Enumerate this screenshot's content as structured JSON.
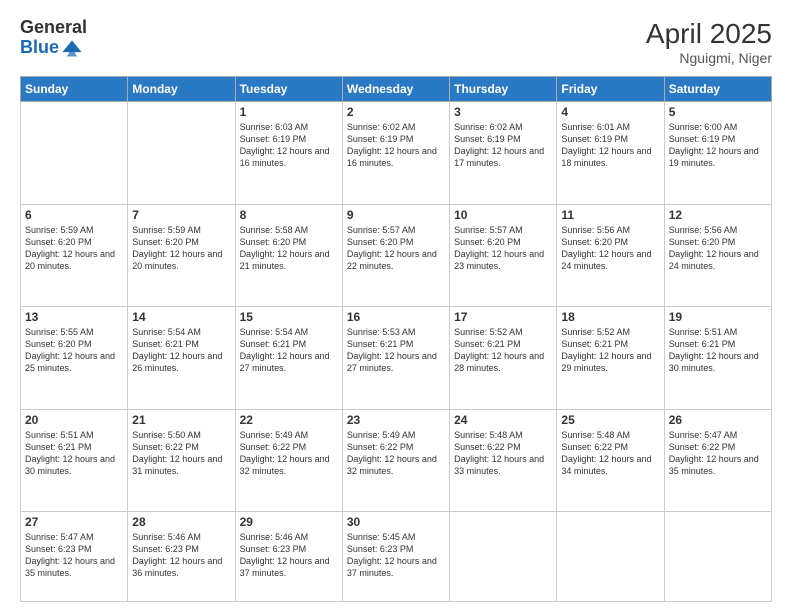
{
  "header": {
    "logo_general": "General",
    "logo_blue": "Blue",
    "month_year": "April 2025",
    "location": "Nguigmi, Niger"
  },
  "days_of_week": [
    "Sunday",
    "Monday",
    "Tuesday",
    "Wednesday",
    "Thursday",
    "Friday",
    "Saturday"
  ],
  "weeks": [
    [
      {
        "day": "",
        "info": ""
      },
      {
        "day": "",
        "info": ""
      },
      {
        "day": "1",
        "info": "Sunrise: 6:03 AM\nSunset: 6:19 PM\nDaylight: 12 hours and 16 minutes."
      },
      {
        "day": "2",
        "info": "Sunrise: 6:02 AM\nSunset: 6:19 PM\nDaylight: 12 hours and 16 minutes."
      },
      {
        "day": "3",
        "info": "Sunrise: 6:02 AM\nSunset: 6:19 PM\nDaylight: 12 hours and 17 minutes."
      },
      {
        "day": "4",
        "info": "Sunrise: 6:01 AM\nSunset: 6:19 PM\nDaylight: 12 hours and 18 minutes."
      },
      {
        "day": "5",
        "info": "Sunrise: 6:00 AM\nSunset: 6:19 PM\nDaylight: 12 hours and 19 minutes."
      }
    ],
    [
      {
        "day": "6",
        "info": "Sunrise: 5:59 AM\nSunset: 6:20 PM\nDaylight: 12 hours and 20 minutes."
      },
      {
        "day": "7",
        "info": "Sunrise: 5:59 AM\nSunset: 6:20 PM\nDaylight: 12 hours and 20 minutes."
      },
      {
        "day": "8",
        "info": "Sunrise: 5:58 AM\nSunset: 6:20 PM\nDaylight: 12 hours and 21 minutes."
      },
      {
        "day": "9",
        "info": "Sunrise: 5:57 AM\nSunset: 6:20 PM\nDaylight: 12 hours and 22 minutes."
      },
      {
        "day": "10",
        "info": "Sunrise: 5:57 AM\nSunset: 6:20 PM\nDaylight: 12 hours and 23 minutes."
      },
      {
        "day": "11",
        "info": "Sunrise: 5:56 AM\nSunset: 6:20 PM\nDaylight: 12 hours and 24 minutes."
      },
      {
        "day": "12",
        "info": "Sunrise: 5:56 AM\nSunset: 6:20 PM\nDaylight: 12 hours and 24 minutes."
      }
    ],
    [
      {
        "day": "13",
        "info": "Sunrise: 5:55 AM\nSunset: 6:20 PM\nDaylight: 12 hours and 25 minutes."
      },
      {
        "day": "14",
        "info": "Sunrise: 5:54 AM\nSunset: 6:21 PM\nDaylight: 12 hours and 26 minutes."
      },
      {
        "day": "15",
        "info": "Sunrise: 5:54 AM\nSunset: 6:21 PM\nDaylight: 12 hours and 27 minutes."
      },
      {
        "day": "16",
        "info": "Sunrise: 5:53 AM\nSunset: 6:21 PM\nDaylight: 12 hours and 27 minutes."
      },
      {
        "day": "17",
        "info": "Sunrise: 5:52 AM\nSunset: 6:21 PM\nDaylight: 12 hours and 28 minutes."
      },
      {
        "day": "18",
        "info": "Sunrise: 5:52 AM\nSunset: 6:21 PM\nDaylight: 12 hours and 29 minutes."
      },
      {
        "day": "19",
        "info": "Sunrise: 5:51 AM\nSunset: 6:21 PM\nDaylight: 12 hours and 30 minutes."
      }
    ],
    [
      {
        "day": "20",
        "info": "Sunrise: 5:51 AM\nSunset: 6:21 PM\nDaylight: 12 hours and 30 minutes."
      },
      {
        "day": "21",
        "info": "Sunrise: 5:50 AM\nSunset: 6:22 PM\nDaylight: 12 hours and 31 minutes."
      },
      {
        "day": "22",
        "info": "Sunrise: 5:49 AM\nSunset: 6:22 PM\nDaylight: 12 hours and 32 minutes."
      },
      {
        "day": "23",
        "info": "Sunrise: 5:49 AM\nSunset: 6:22 PM\nDaylight: 12 hours and 32 minutes."
      },
      {
        "day": "24",
        "info": "Sunrise: 5:48 AM\nSunset: 6:22 PM\nDaylight: 12 hours and 33 minutes."
      },
      {
        "day": "25",
        "info": "Sunrise: 5:48 AM\nSunset: 6:22 PM\nDaylight: 12 hours and 34 minutes."
      },
      {
        "day": "26",
        "info": "Sunrise: 5:47 AM\nSunset: 6:22 PM\nDaylight: 12 hours and 35 minutes."
      }
    ],
    [
      {
        "day": "27",
        "info": "Sunrise: 5:47 AM\nSunset: 6:23 PM\nDaylight: 12 hours and 35 minutes."
      },
      {
        "day": "28",
        "info": "Sunrise: 5:46 AM\nSunset: 6:23 PM\nDaylight: 12 hours and 36 minutes."
      },
      {
        "day": "29",
        "info": "Sunrise: 5:46 AM\nSunset: 6:23 PM\nDaylight: 12 hours and 37 minutes."
      },
      {
        "day": "30",
        "info": "Sunrise: 5:45 AM\nSunset: 6:23 PM\nDaylight: 12 hours and 37 minutes."
      },
      {
        "day": "",
        "info": ""
      },
      {
        "day": "",
        "info": ""
      },
      {
        "day": "",
        "info": ""
      }
    ]
  ]
}
